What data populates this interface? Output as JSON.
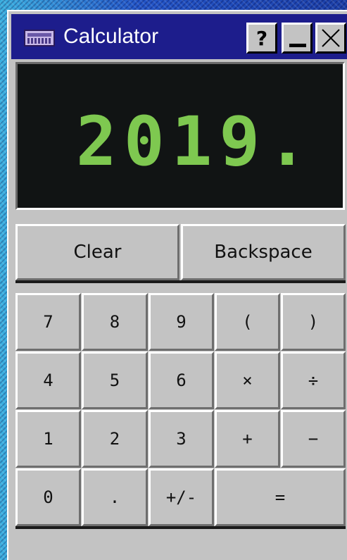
{
  "window": {
    "title": "Calculator",
    "help_label": "?"
  },
  "display": {
    "value": "2019."
  },
  "controls": {
    "clear_label": "Clear",
    "backspace_label": "Backspace"
  },
  "keypad": {
    "row1": [
      "7",
      "8",
      "9",
      "(",
      ")"
    ],
    "row2": [
      "4",
      "5",
      "6",
      "×",
      "÷"
    ],
    "row3": [
      "1",
      "2",
      "3",
      "+",
      "−"
    ],
    "row4": [
      "0",
      ".",
      "+/-",
      "="
    ]
  },
  "colors": {
    "titlebar": "#1d1d8c",
    "display_bg": "#111414",
    "display_text": "#7ec850",
    "button_face": "#c3c3c3"
  },
  "icons": {
    "app": "calculator-icon",
    "help": "question-mark-icon",
    "minimize": "minimize-icon",
    "close": "close-icon"
  }
}
